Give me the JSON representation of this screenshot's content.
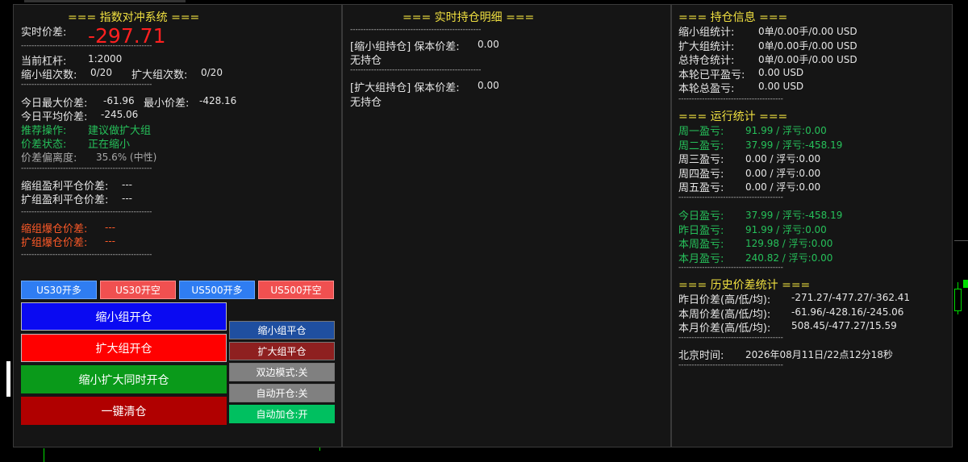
{
  "left": {
    "title": "=== 指数对冲系统 ===",
    "spread_label": "实时价差:",
    "spread_value": "-297.71",
    "leverage_label": "当前杠杆:",
    "leverage_value": "1:2000",
    "shrink_count_label": "缩小组次数:",
    "shrink_count_value": "0/20",
    "expand_count_label": "扩大组次数:",
    "expand_count_value": "0/20",
    "today_max_label": "今日最大价差:",
    "today_max_value": "-61.96",
    "today_min_label": "最小价差:",
    "today_min_value": "-428.16",
    "today_avg_label": "今日平均价差:",
    "today_avg_value": "-245.06",
    "recommend_label": "推荐操作:",
    "recommend_value": "建议做扩大组",
    "status_label": "价差状态:",
    "status_value": "正在缩小",
    "deviation_label": "价差偏离度:",
    "deviation_value": "35.6% (中性)",
    "shrink_tp_label": "缩组盈利平仓价差:",
    "shrink_tp_value": "---",
    "expand_tp_label": "扩组盈利平仓价差:",
    "expand_tp_value": "---",
    "shrink_liq_label": "缩组爆仓价差:",
    "shrink_liq_value": "---",
    "expand_liq_label": "扩组爆仓价差:",
    "expand_liq_value": "---",
    "buttons": {
      "us30_long": "US30开多",
      "us30_short": "US30开空",
      "us500_long": "US500开多",
      "us500_short": "US500开空",
      "open_shrink": "缩小组开仓",
      "open_expand": "扩大组开仓",
      "open_both": "缩小扩大同时开仓",
      "close_all": "一键清仓",
      "close_shrink": "缩小组平仓",
      "close_expand": "扩大组平仓",
      "dual_mode": "双边模式:关",
      "auto_open": "自动开仓:关",
      "auto_add": "自动加仓:开"
    }
  },
  "middle": {
    "title": "=== 实时持仓明细 ===",
    "shrink_header": "[缩小组持仓] 保本价差:",
    "shrink_breakeven": "0.00",
    "shrink_none": "无持仓",
    "expand_header": "[扩大组持仓] 保本价差:",
    "expand_breakeven": "0.00",
    "expand_none": "无持仓"
  },
  "right": {
    "pos_title": "=== 持仓信息 ===",
    "pos_rows": [
      {
        "label": "缩小组统计:",
        "value": "0单/0.00手/0.00 USD"
      },
      {
        "label": "扩大组统计:",
        "value": "0单/0.00手/0.00 USD"
      },
      {
        "label": "总持仓统计:",
        "value": "0单/0.00手/0.00 USD"
      },
      {
        "label": "本轮已平盈亏:",
        "value": "0.00 USD"
      },
      {
        "label": "本轮总盈亏:",
        "value": "0.00 USD"
      }
    ],
    "run_title": "=== 运行统计 ===",
    "week_rows": [
      {
        "label": "周一盈亏:",
        "value": "91.99 / 浮亏:0.00"
      },
      {
        "label": "周二盈亏:",
        "value": "37.99 / 浮亏:-458.19"
      },
      {
        "label": "周三盈亏:",
        "value": "0.00 / 浮亏:0.00"
      },
      {
        "label": "周四盈亏:",
        "value": "0.00 / 浮亏:0.00"
      },
      {
        "label": "周五盈亏:",
        "value": "0.00 / 浮亏:0.00"
      }
    ],
    "period_rows": [
      {
        "label": "今日盈亏:",
        "value": "37.99 / 浮亏:-458.19"
      },
      {
        "label": "昨日盈亏:",
        "value": "91.99 / 浮亏:0.00"
      },
      {
        "label": "本周盈亏:",
        "value": "129.98 / 浮亏:0.00"
      },
      {
        "label": "本月盈亏:",
        "value": "240.82 / 浮亏:0.00"
      }
    ],
    "hist_title": "=== 历史价差统计 ===",
    "hist_rows": [
      {
        "label": "昨日价差(高/低/均):",
        "value": "-271.27/-477.27/-362.41"
      },
      {
        "label": "本周价差(高/低/均):",
        "value": "-61.96/-428.16/-245.06"
      },
      {
        "label": "本月价差(高/低/均):",
        "value": "508.45/-477.27/15.59"
      }
    ],
    "time_label": "北京时间:",
    "time_value": "2026年08月11日/22点12分18秒"
  },
  "colors": {
    "title": "#f0e040",
    "positive": "#26c05a",
    "warning": "#ff5a28",
    "spread": "#ff2020",
    "btn_blue": "#2f7df2",
    "btn_red": "#f05050",
    "open_shrink": "#0a0af2",
    "open_expand": "#ff0000",
    "open_both": "#0a9a1a",
    "close_all": "#b00000",
    "close_shrink": "#1f4fa0",
    "close_expand": "#8e2020",
    "toggle_off": "#808080",
    "toggle_on": "#00c060"
  }
}
